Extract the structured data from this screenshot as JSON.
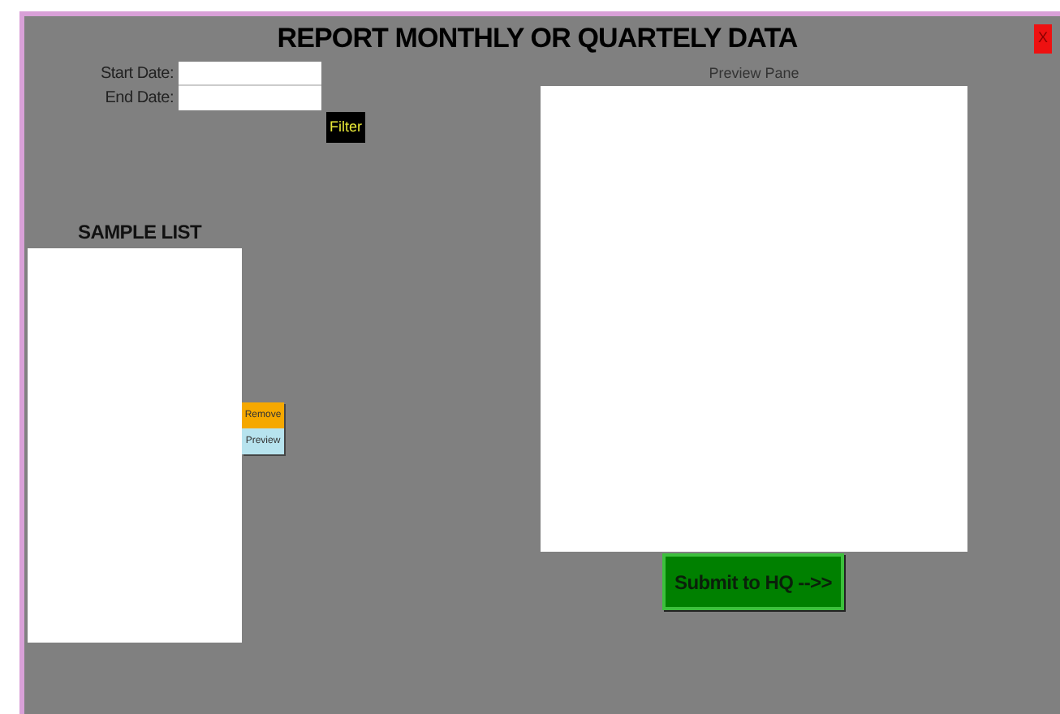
{
  "window": {
    "title": "REPORT MONTHLY OR QUARTELY DATA",
    "close_button": "X"
  },
  "filter": {
    "start_date": {
      "label": "Start Date:"
    },
    "end_date": {
      "label": "End Date:"
    },
    "button": "Filter"
  },
  "sample_list": {
    "title": "SAMPLE LIST",
    "buttons": [
      {
        "kind": "remove",
        "label": "Remove"
      },
      {
        "kind": "preview",
        "label": "Preview"
      }
    ]
  },
  "preview": {
    "title": "Preview Pane"
  },
  "submit_button": "Submit to HQ -->>"
}
